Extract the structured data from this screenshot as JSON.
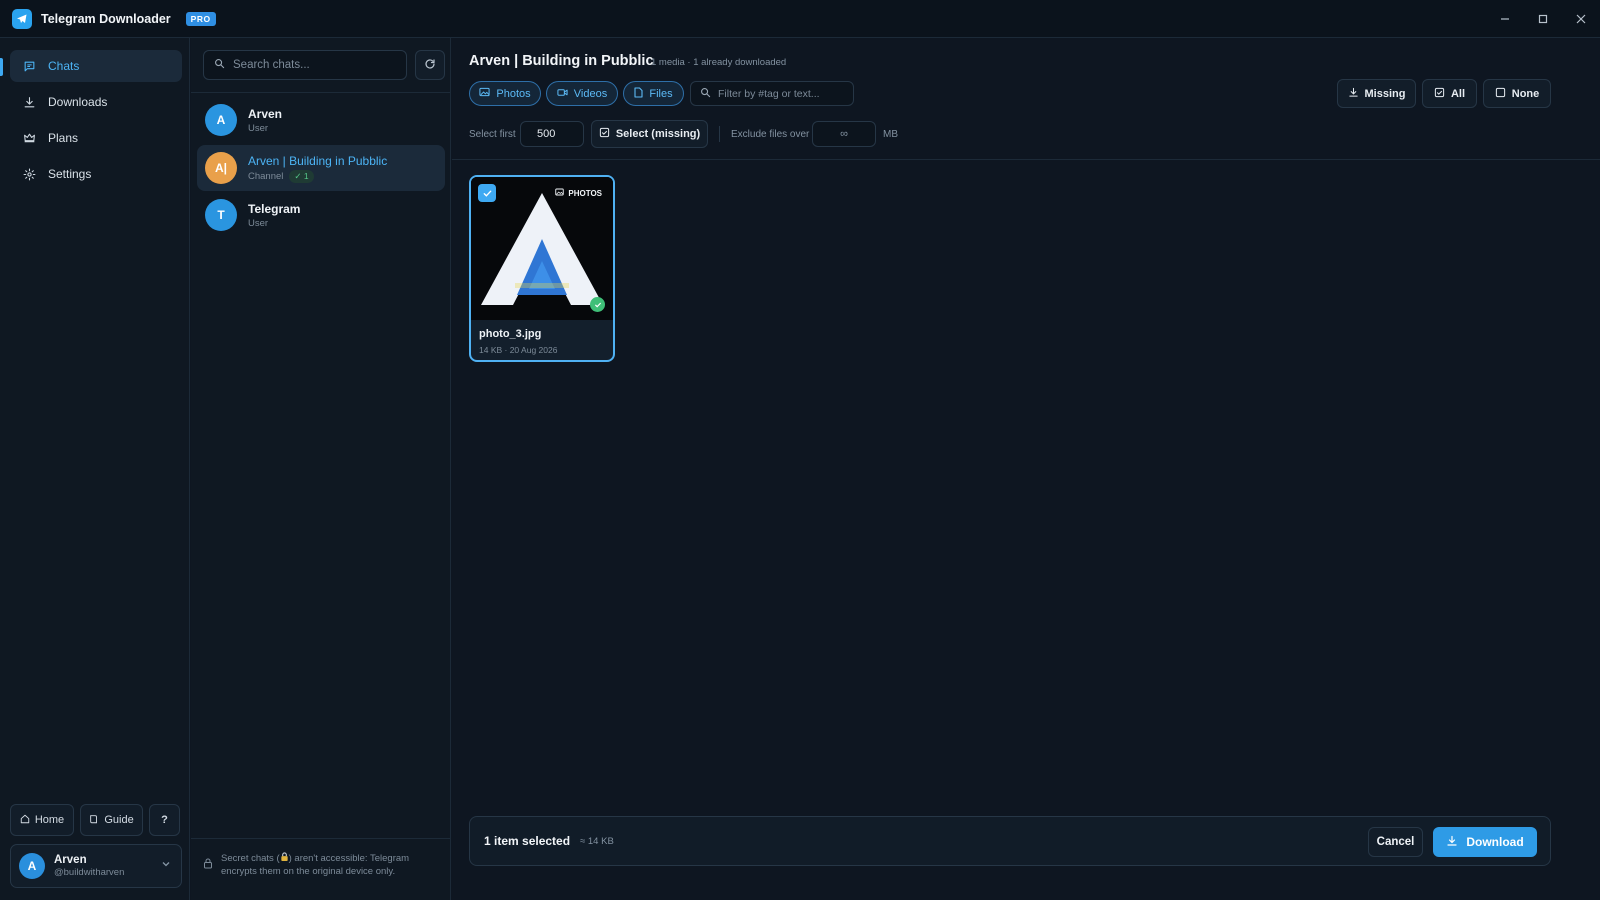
{
  "app": {
    "title": "Telegram Downloader",
    "badge": "PRO",
    "logo_icon": "telegram-plane-icon"
  },
  "window_controls": {
    "minimize_icon": "minimize-icon",
    "maximize_icon": "maximize-icon",
    "close_icon": "close-icon"
  },
  "nav": {
    "items": [
      {
        "label": "Chats",
        "icon": "chat-icon",
        "active": true
      },
      {
        "label": "Downloads",
        "icon": "download-icon",
        "active": false
      },
      {
        "label": "Plans",
        "icon": "crown-icon",
        "active": false
      },
      {
        "label": "Settings",
        "icon": "gear-icon",
        "active": false
      }
    ],
    "bottom": {
      "home_label": "Home",
      "guide_label": "Guide",
      "help_label": "?"
    },
    "profile": {
      "initial": "A",
      "name": "Arven",
      "handle": "@buildwitharven"
    }
  },
  "chat_list": {
    "search_placeholder": "Search chats...",
    "chats": [
      {
        "initial": "A",
        "name": "Arven",
        "type": "User",
        "avatar_color": "#2a95e0",
        "active": false
      },
      {
        "initial": "A|",
        "name": "Arven | Building in Pubblic",
        "type": "Channel",
        "badge": "✓ 1",
        "avatar_color": "#e9a04a",
        "active": true
      },
      {
        "initial": "T",
        "name": "Telegram",
        "type": "User",
        "avatar_color": "#2a95e0",
        "active": false
      }
    ],
    "secret_note_1": "Secret chats (",
    "secret_note_2": ") aren't accessible: Telegram encrypts them on the original device only."
  },
  "main": {
    "title": "Arven | Building in Pubblic",
    "meta": "1 media · 1 already downloaded",
    "filters": {
      "photos": "Photos",
      "videos": "Videos",
      "files": "Files",
      "search_placeholder": "Filter by #tag or text..."
    },
    "toolbar": {
      "missing": "Missing",
      "all": "All",
      "none": "None"
    },
    "select_first_label": "Select first",
    "select_first_value": "500",
    "select_missing_label": "Select (missing)",
    "exclude_label": "Exclude files over",
    "exclude_value": "∞",
    "exclude_unit": "MB",
    "media": [
      {
        "type_label": "PHOTOS",
        "name": "photo_3.jpg",
        "meta": "14 KB · 20 Aug 2026",
        "selected": true,
        "downloaded": true
      }
    ],
    "selection": {
      "count_text": "1 item selected",
      "size_text": "≈ 14 KB",
      "cancel": "Cancel",
      "download": "Download"
    }
  },
  "colors": {
    "accent": "#3ea9f2",
    "success": "#3fbf78",
    "background": "#0e1621"
  }
}
